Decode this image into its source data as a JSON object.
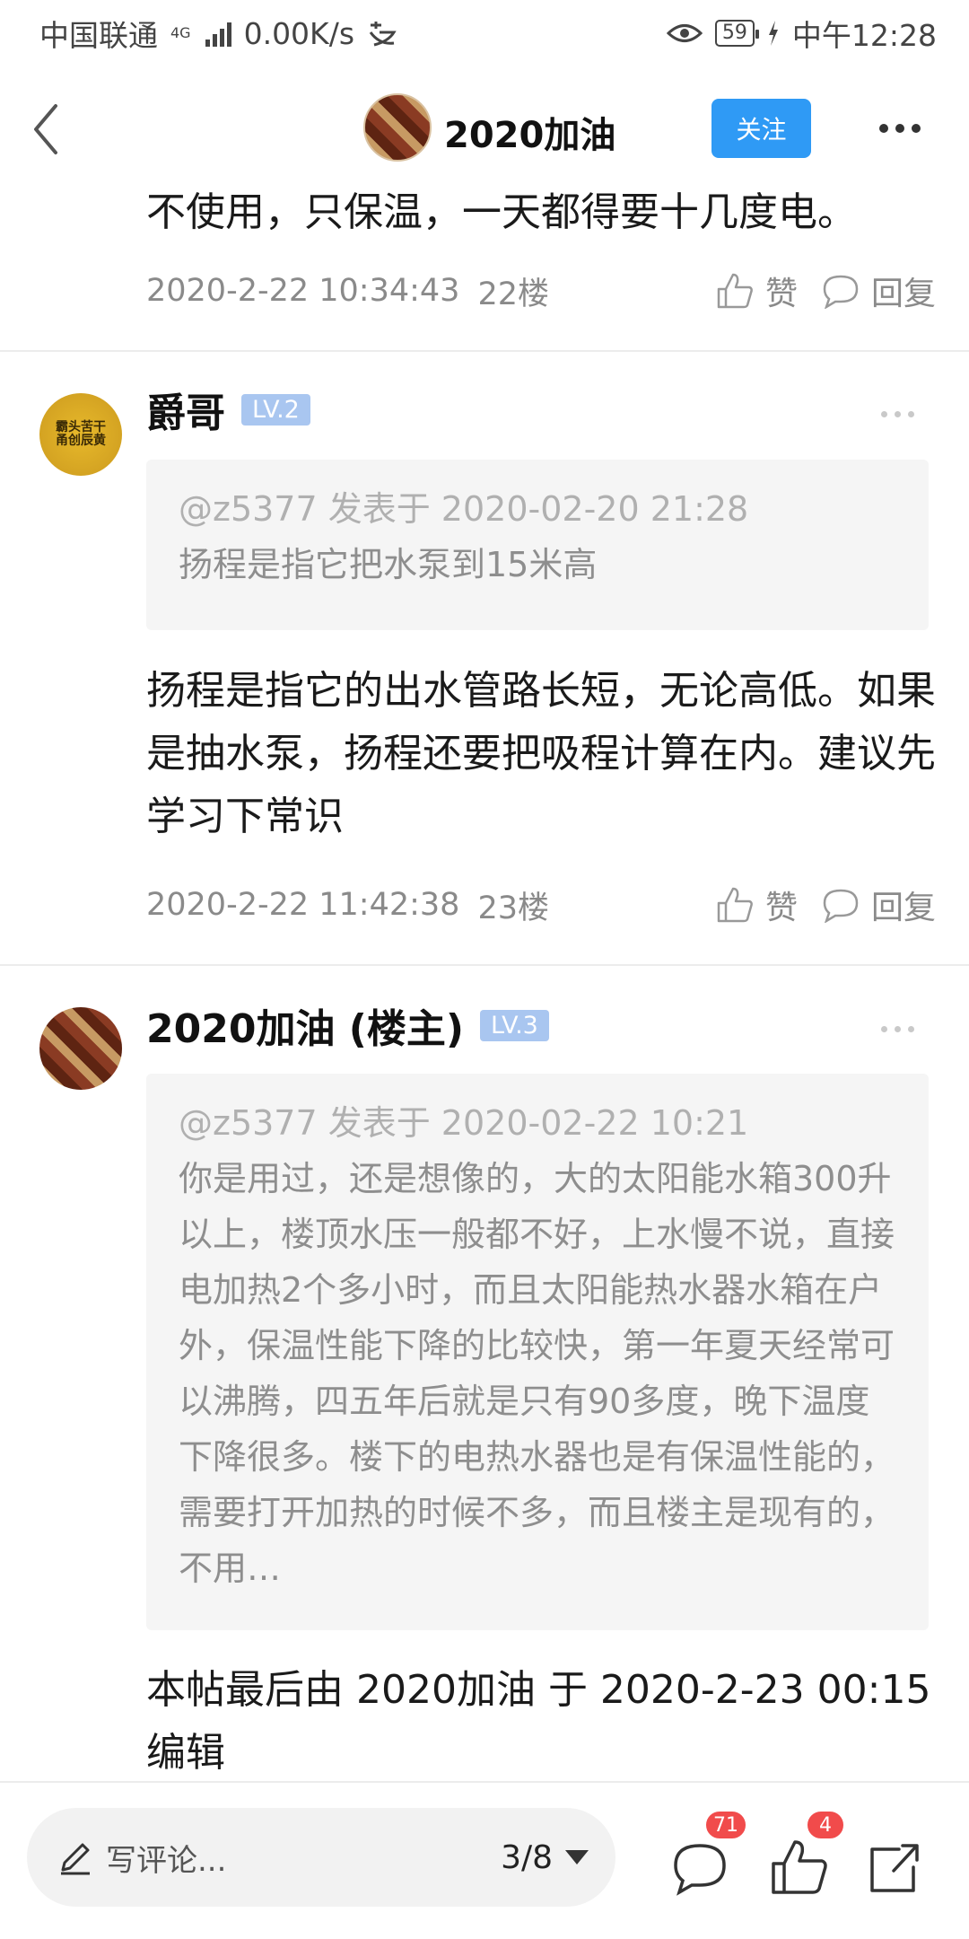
{
  "status_bar": {
    "carrier": "中国联通",
    "network": "4G",
    "speed": "0.00K/s",
    "battery": "59",
    "time": "中午12:28"
  },
  "nav": {
    "title": "2020加油",
    "follow_label": "关注"
  },
  "posts": [
    {
      "text": "不使用，只保温，一天都得要十几度电。",
      "timestamp": "2020-2-22 10:34:43",
      "floor": "22楼",
      "like_label": "赞",
      "reply_label": "回复"
    },
    {
      "username": "爵哥",
      "level": "LV.2",
      "avatar_text": "霸头苦干 甬创辰黄",
      "quote_head": "@z5377 发表于 2020-02-20 21:28",
      "quote_body": "扬程是指它把水泵到15米高",
      "text": "扬程是指它的出水管路长短，无论高低。如果是抽水泵，扬程还要把吸程计算在内。建议先学习下常识",
      "timestamp": "2020-2-22 11:42:38",
      "floor": "23楼",
      "like_label": "赞",
      "reply_label": "回复"
    },
    {
      "username": "2020加油 (楼主)",
      "level": "LV.3",
      "quote_head": "@z5377 发表于 2020-02-22 10:21",
      "quote_body": "你是用过，还是想像的，大的太阳能水箱300升以上，楼顶水压一般都不好，上水慢不说，直接电加热2个多小时，而且太阳能热水器水箱在户外，保温性能下降的比较快，第一年夏天经常可以沸腾，四五年后就是只有90多度，晚下温度下降很多。楼下的电热水器也是有保温性能的，需要打开加热的时候不多，而且楼主是现有的，不用…",
      "text": "本帖最后由 2020加油 于 2020-2-23 00:15 编辑"
    }
  ],
  "bottom_bar": {
    "comment_placeholder": "写评论...",
    "page_indicator": "3/8",
    "comment_count": "71",
    "like_count": "4"
  },
  "icons": {
    "back": "back-icon",
    "more": "more-icon",
    "like": "thumb-up-icon",
    "reply": "comment-bubble-icon",
    "pencil": "pencil-icon",
    "share": "share-icon"
  }
}
